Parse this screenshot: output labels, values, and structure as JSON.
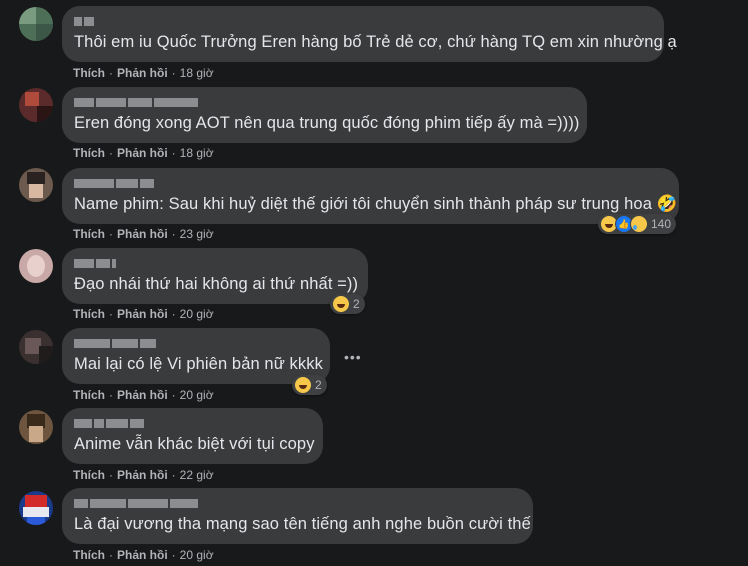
{
  "comments": [
    {
      "text": "Thôi em iu Quốc Trưởng Eren hàng bố Trẻ dẻ cơ, chứ hàng TQ em xin nhường ạ",
      "like": "Thích",
      "reply": "Phản hồi",
      "time": "18 giờ"
    },
    {
      "text": "Eren đóng xong AOT nên qua trung quốc đóng phim tiếp ấy mà =))))",
      "like": "Thích",
      "reply": "Phản hồi",
      "time": "18 giờ"
    },
    {
      "text": "Name phim: Sau khi huỷ diệt thế giới tôi chuyển sinh thành pháp sư trung hoa 🤣",
      "like": "Thích",
      "reply": "Phản hồi",
      "time": "23 giờ",
      "reactions": {
        "count": "140",
        "icons": [
          "haha-icon",
          "like-icon",
          "sad-icon"
        ]
      }
    },
    {
      "text": "Đạo nhái thứ hai không ai thứ nhất =))",
      "like": "Thích",
      "reply": "Phản hồi",
      "time": "20 giờ",
      "reactions": {
        "count": "2",
        "icons": [
          "haha-icon"
        ]
      }
    },
    {
      "text": "Mai lại có lệ Vi phiên bản nữ kkkk",
      "like": "Thích",
      "reply": "Phản hồi",
      "time": "20 giờ",
      "reactions": {
        "count": "2",
        "icons": [
          "haha-icon"
        ]
      }
    },
    {
      "text": "Anime vẫn khác biệt với tụi copy",
      "like": "Thích",
      "reply": "Phản hồi",
      "time": "22 giờ"
    },
    {
      "text": "Là đại vương tha mạng sao tên tiếng anh nghe buồn cười thế",
      "like": "Thích",
      "reply": "Phản hồi",
      "time": "20 giờ"
    }
  ],
  "more_icon": "more-horizontal-icon",
  "more_text": "•••",
  "dot": "·",
  "colors": {
    "background": "#18191a",
    "bubble": "#3a3b3c",
    "text": "#e4e6eb",
    "meta": "#b0b3b8"
  }
}
